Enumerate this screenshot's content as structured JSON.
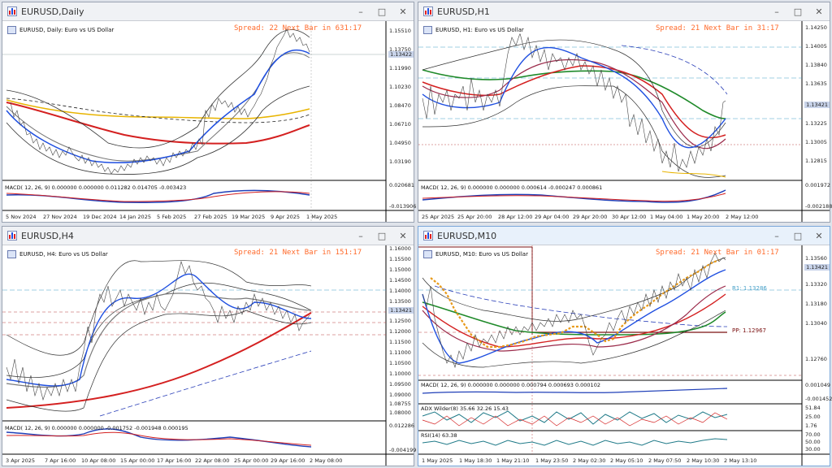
{
  "colors": {
    "bull": "#1f4fe0",
    "bear": "#e0201f",
    "ma_red": "#d42020",
    "ma_green": "#1f8a2a",
    "ma_gold": "#e8b400",
    "ma_grey": "#7a7a7a",
    "spread": "#ff6a2b"
  },
  "windows": [
    {
      "title": "EURUSD,Daily",
      "header": "EURUSD, Daily:  Euro vs US Dollar",
      "spread": "Spread: 22  Next Bar in 631:17",
      "macd_label": "MACD( 12, 26, 9) 0.000000 0.000000 0.011282 0.014705 -0.003423",
      "price_labels": [
        "1.15510",
        "1.13750",
        "1.11990",
        "1.10230",
        "1.08470",
        "1.06710",
        "1.04950",
        "1.03190"
      ],
      "current_price": "1.13422",
      "macd_scale": [
        "0.020681",
        "-0.013906"
      ],
      "time_labels": [
        "5 Nov 2024",
        "27 Nov 2024",
        "19 Dec 2024",
        "14 Jan 2025",
        "5 Feb 2025",
        "27 Feb 2025",
        "19 Mar 2025",
        "9 Apr 2025",
        "1 May 2025"
      ]
    },
    {
      "title": "EURUSD,H1",
      "header": "EURUSD, H1:  Euro vs US Dollar",
      "spread": "Spread: 21  Next Bar in 31:17",
      "macd_label": "MACD( 12, 26, 9) 0.000000 0.000000 0.000614 -0.000247 0.000861",
      "price_labels": [
        "1.14250",
        "1.14005",
        "1.13840",
        "1.13635",
        "1.13421",
        "1.13225",
        "1.13005",
        "1.12815"
      ],
      "current_price": "1.13421",
      "macd_scale": [
        "0.001972",
        "-0.002188"
      ],
      "time_labels": [
        "25 Apr 2025",
        "25 Apr 20:00",
        "28 Apr 12:00",
        "29 Apr 04:00",
        "29 Apr 20:00",
        "30 Apr 12:00",
        "1 May 04:00",
        "1 May 20:00",
        "2 May 12:00"
      ]
    },
    {
      "title": "EURUSD,H4",
      "header": "EURUSD, H4:  Euro vs US Dollar",
      "spread": "Spread: 21  Next Bar in 151:17",
      "macd_label": "MACD( 12, 26, 9) 0.000000 0.000000 -0.001752 -0.001948 0.000195",
      "price_labels": [
        "1.16000",
        "1.15500",
        "1.15000",
        "1.14500",
        "1.14000",
        "1.13500",
        "1.13000",
        "1.12500",
        "1.12000",
        "1.11500",
        "1.11000",
        "1.10500",
        "1.10000",
        "1.09500",
        "1.09000",
        "1.08755",
        "1.08000"
      ],
      "current_price": "1.13421",
      "macd_scale": [
        "0.012286",
        "-0.004199"
      ],
      "time_labels": [
        "3 Apr 2025",
        "7 Apr 16:00",
        "10 Apr 08:00",
        "15 Apr 00:00",
        "17 Apr 16:00",
        "22 Apr 08:00",
        "25 Apr 00:00",
        "29 Apr 16:00",
        "2 May 08:00"
      ]
    },
    {
      "title": "EURUSD,M10",
      "header": "EURUSD, M10:  Euro vs US Dollar",
      "spread": "Spread: 21  Next Bar in 01:17",
      "macd_label": "MACD( 12, 26, 9) 0.000000 0.000000 0.000794 0.000693 0.000102",
      "adx_label": "ADX Wilder(8) 35.66 32.26 15.43",
      "rsi_label": "RSI(14) 63.38",
      "r1_label": "R1: 1.13286",
      "pp_label": "PP: 1.12967",
      "price_labels": [
        "1.13560",
        "1.13440",
        "1.13320",
        "1.13180",
        "1.13040",
        "1.12760"
      ],
      "current_price": "1.13421",
      "macd_scale": [
        "0.001049",
        "-0.001452"
      ],
      "adx_scale": [
        "51.84",
        "25.00",
        "1.76"
      ],
      "rsi_scale": [
        "70.00",
        "50.00",
        "30.00"
      ],
      "time_labels": [
        "1 May 2025",
        "1 May 18:30",
        "1 May 21:10",
        "1 May 23:50",
        "2 May 02:30",
        "2 May 05:10",
        "2 May 07:50",
        "2 May 10:30",
        "2 May 13:10"
      ]
    }
  ],
  "window_buttons": {
    "minimize": "–",
    "maximize": "□",
    "close": "✕"
  }
}
